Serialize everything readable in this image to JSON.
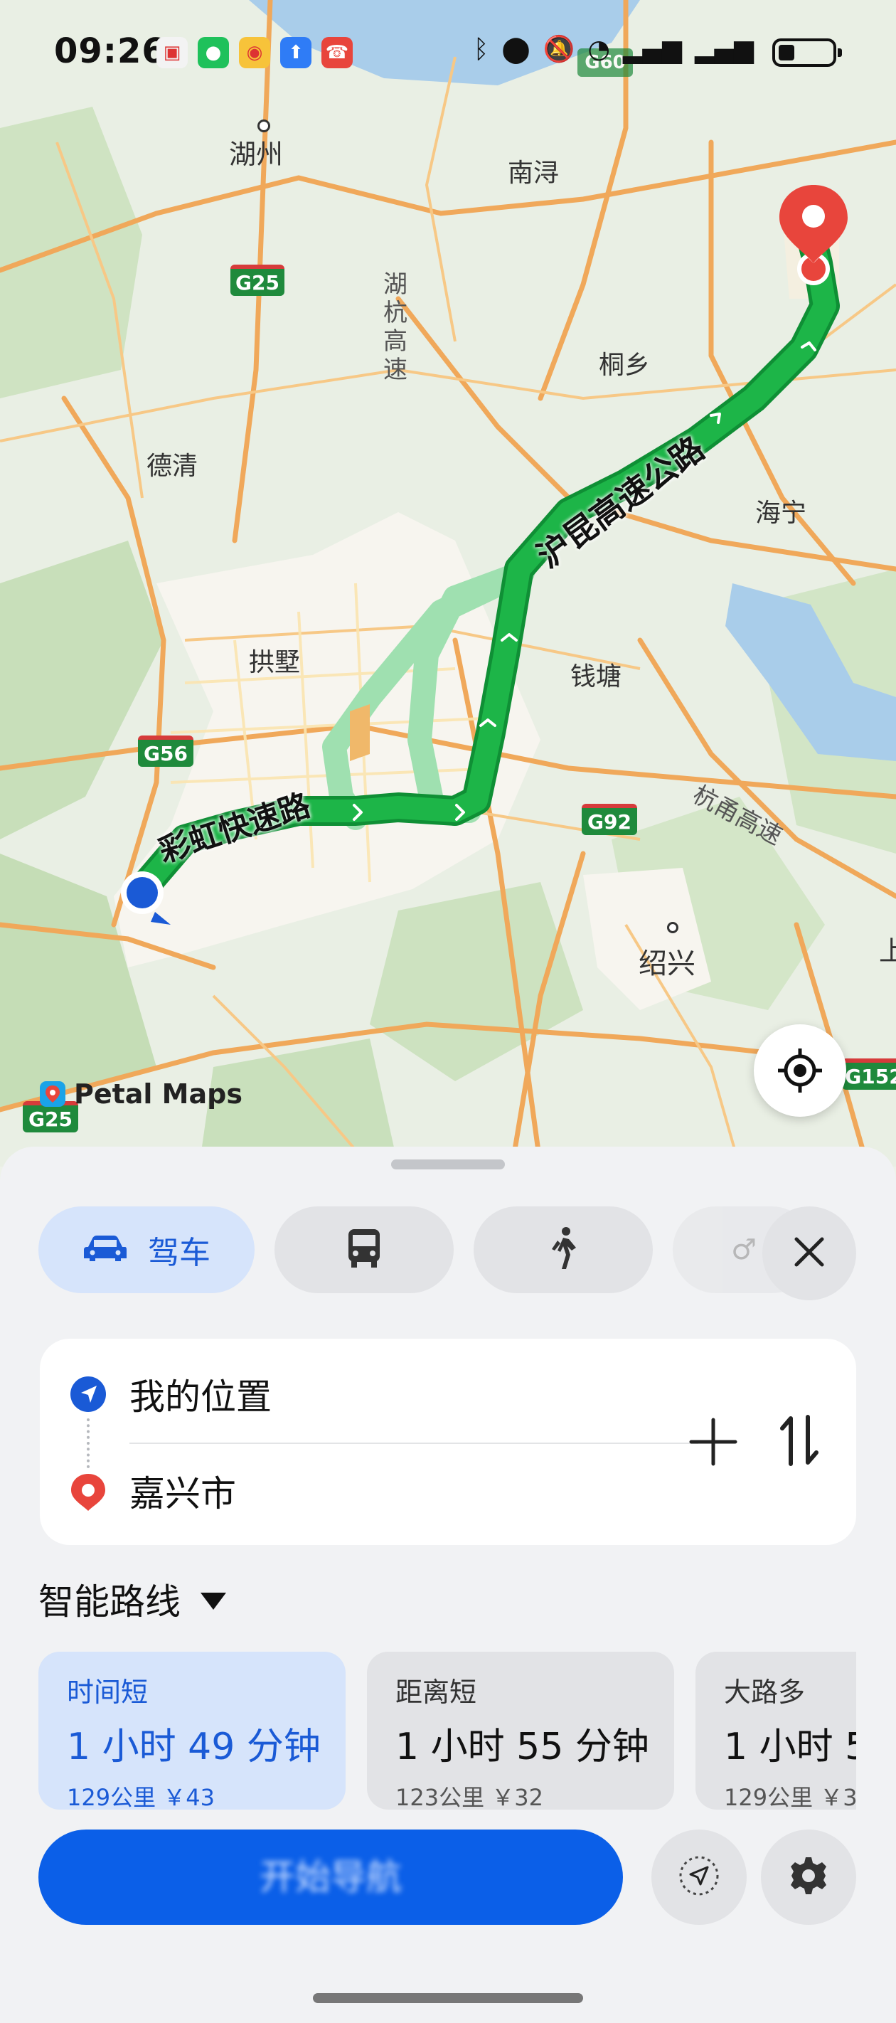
{
  "status_bar": {
    "time": "09:26"
  },
  "map": {
    "labels": {
      "huzhou": "湖州",
      "nanxun": "南浔",
      "tongxiang": "桐乡",
      "deqing": "德清",
      "haining": "海宁",
      "gongshu": "拱墅",
      "qiantang": "钱塘",
      "shaoxing": "绍兴",
      "huhang": "湖杭高速",
      "hangyong": "杭甬高速",
      "huhang_v": "湖\n杭\n高\n速",
      "shang": "上"
    },
    "road_badges": {
      "g25a": "G25",
      "g56": "G56",
      "g92": "G92",
      "g25b": "G25",
      "g60": "G60",
      "g152": "G152"
    },
    "route_labels": {
      "rainbow": "彩虹快速路",
      "hukun": "沪昆高速公路"
    },
    "brand": "Petal Maps",
    "colors": {
      "route": "#1db548",
      "alt_route": "#9fe0b0",
      "destination": "#e8453c",
      "origin": "#1a5ad6"
    }
  },
  "modes": [
    {
      "icon": "car-icon",
      "label": "驾车",
      "active": true
    },
    {
      "icon": "bus-icon",
      "label": "",
      "active": false
    },
    {
      "icon": "walk-icon",
      "label": "",
      "active": false
    },
    {
      "icon": "bike-icon",
      "label": "",
      "active": false
    }
  ],
  "locations": {
    "origin": "我的位置",
    "destination": "嘉兴市"
  },
  "smart_route_label": "智能路线",
  "routes": [
    {
      "tag": "时间短",
      "duration": "1 小时 49 分钟",
      "meta": "129公里 ￥43",
      "active": true
    },
    {
      "tag": "距离短",
      "duration": "1 小时 55 分钟",
      "meta": "123公里 ￥32",
      "active": false
    },
    {
      "tag": "大路多",
      "duration": "1 小时 5",
      "meta": "129公里 ￥3",
      "active": false
    }
  ],
  "start_button_label": "开始导航"
}
